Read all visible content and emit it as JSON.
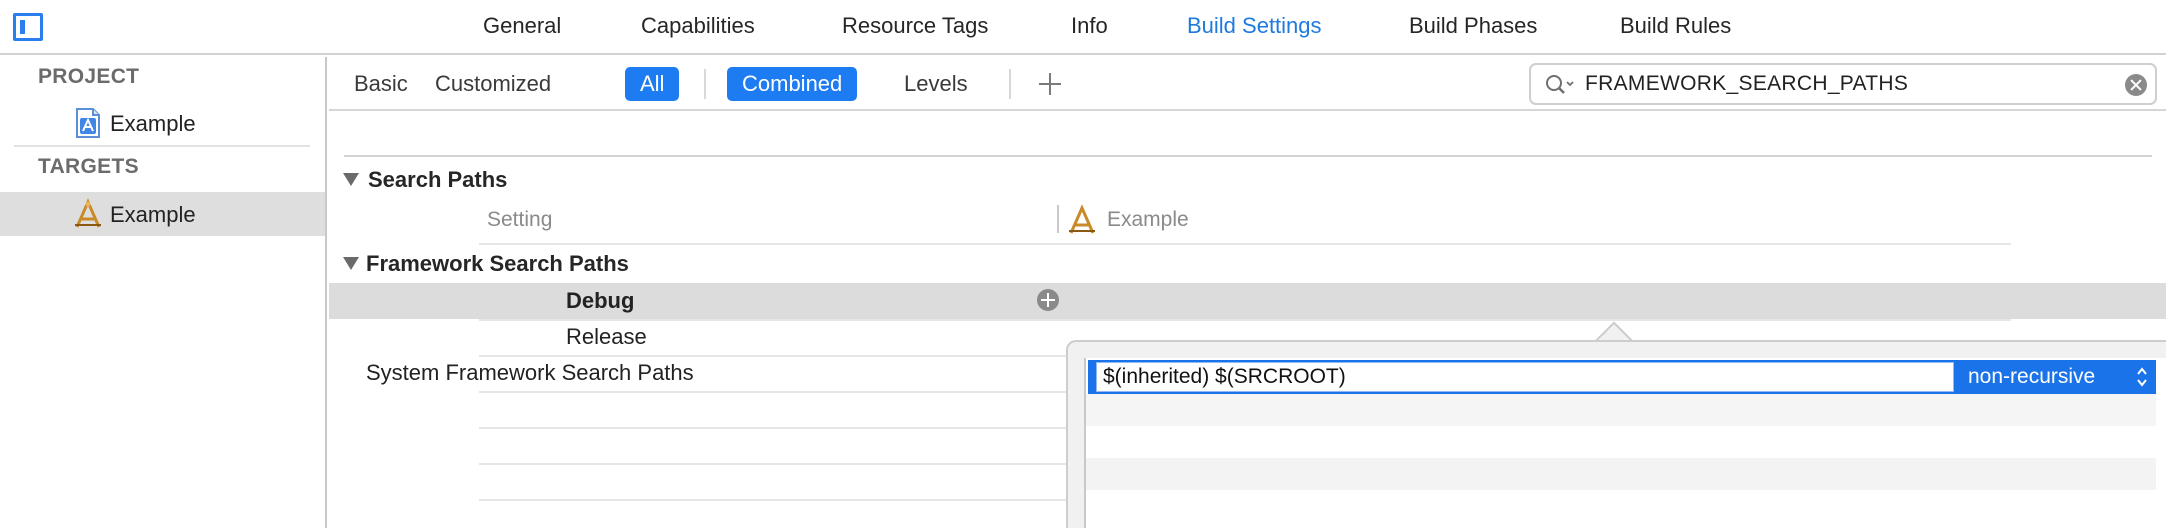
{
  "tabs": [
    {
      "label": "General"
    },
    {
      "label": "Capabilities"
    },
    {
      "label": "Resource Tags"
    },
    {
      "label": "Info"
    },
    {
      "label": "Build Settings",
      "active": true
    },
    {
      "label": "Build Phases"
    },
    {
      "label": "Build Rules"
    }
  ],
  "navigator": {
    "project_header": "PROJECT",
    "project_item": "Example",
    "targets_header": "TARGETS",
    "target_item": "Example"
  },
  "filter": {
    "basic": "Basic",
    "customized": "Customized",
    "all": "All",
    "combined": "Combined",
    "levels": "Levels"
  },
  "search": {
    "value": "FRAMEWORK_SEARCH_PATHS"
  },
  "settings": {
    "group_title": "Search Paths",
    "col_setting": "Setting",
    "col_target": "Example",
    "setting_name": "Framework Search Paths",
    "debug_label": "Debug",
    "release_label": "Release",
    "system_setting_name": "System Framework Search Paths"
  },
  "popover": {
    "path_value": "$(inherited) $(SRCROOT)",
    "recursion": "non-recursive"
  },
  "colors": {
    "accent": "#1d7cf2",
    "selection": "#1a73e8",
    "row_highlight": "#dcdcdc"
  },
  "icons": [
    "sidebar-toggle-icon",
    "project-file-icon",
    "app-target-icon",
    "search-icon",
    "add-icon",
    "clear-search-icon",
    "add-condition-icon",
    "disclosure-triangle-icon",
    "updown-arrows-icon"
  ]
}
